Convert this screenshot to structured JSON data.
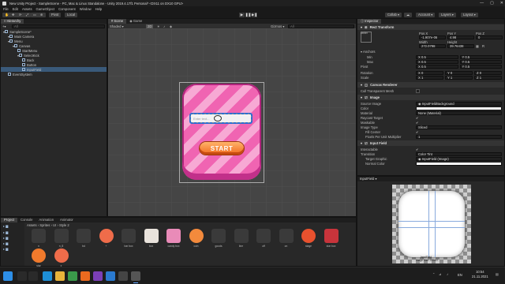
{
  "window": {
    "title": "New Unity Project - SampleScene - PC, Mac & Linux Standalone - Unity 2019.4.17f1 Personal* <DX11 on DX10 GPU>",
    "controls": [
      "—",
      "▢",
      "✕"
    ]
  },
  "menu": [
    "File",
    "Edit",
    "Assets",
    "GameObject",
    "Component",
    "Window",
    "Help"
  ],
  "toolbar": {
    "pivot": "Pivot",
    "local": "Local",
    "collab": "Collab ▾",
    "account": "Account ▾",
    "layers": "Layers ▾",
    "layout": "Layout ▾"
  },
  "hierarchy": {
    "tab": "Hierarchy",
    "search_placeholder": "All",
    "items": [
      {
        "label": "SampleScene*",
        "depth": 0
      },
      {
        "label": "Main Camera",
        "depth": 1
      },
      {
        "label": "Menu",
        "depth": 1
      },
      {
        "label": "Canvas",
        "depth": 2
      },
      {
        "label": "StartMenu",
        "depth": 3
      },
      {
        "label": "SelectKick",
        "depth": 3
      },
      {
        "label": "Back",
        "depth": 4
      },
      {
        "label": "Button",
        "depth": 4
      },
      {
        "label": "InputField",
        "depth": 4,
        "selected": true
      },
      {
        "label": "EventSystem",
        "depth": 1
      }
    ]
  },
  "scene": {
    "tabs": [
      "Scene",
      "Game"
    ],
    "shading": "Shaded",
    "mode_2d": "2D",
    "gizmos": "Gizmos ▾",
    "search_placeholder": "All",
    "input_placeholder": "Enter text...",
    "start_label": "START"
  },
  "inspector": {
    "tab": "Inspector",
    "rect_header": "Rect Transform",
    "anchor_label": "center",
    "pos_headers": [
      "Pos X",
      "Pos Y",
      "Pos Z"
    ],
    "pos_values": [
      "-1.907e-06",
      "4.98",
      "0"
    ],
    "size_headers": [
      "Width",
      "Height"
    ],
    "size_values": [
      "272.0798",
      "39.76438"
    ],
    "anchors_label": "Anchors",
    "min": {
      "label": "Min",
      "x": "X 0.5",
      "y": "Y 0.5"
    },
    "max": {
      "label": "Max",
      "x": "X 0.5",
      "y": "Y 0.5"
    },
    "pivot": {
      "label": "Pivot",
      "x": "X 0.5",
      "y": "Y 0.5"
    },
    "rotation": {
      "label": "Rotation",
      "x": "X 0",
      "y": "Y 0",
      "z": "Z 0"
    },
    "scale": {
      "label": "Scale",
      "x": "X 1",
      "y": "Y 1",
      "z": "Z 1"
    },
    "canvas_renderer": "Canvas Renderer",
    "cull_transparent": "Cull Transparent Mesh",
    "image_header": "Image",
    "source_image": {
      "label": "Source Image",
      "value": "◉ InputFieldBackground"
    },
    "color": {
      "label": "Color"
    },
    "material": {
      "label": "Material",
      "value": "None (Material)"
    },
    "raycast": {
      "label": "Raycast Target"
    },
    "maskable": {
      "label": "Maskable"
    },
    "image_type": {
      "label": "Image Type",
      "value": "Sliced"
    },
    "fill_center": {
      "label": "Fill Center"
    },
    "ppu": {
      "label": "Pixels Per Unit Multiplier",
      "value": "1"
    },
    "input_header": "Input Field",
    "interactable": {
      "label": "Interactable"
    },
    "transition": {
      "label": "Transition",
      "value": "Color Tint"
    },
    "target_graphic": {
      "label": "Target Graphic",
      "value": "◉ InputField (Image)"
    },
    "normal_color": {
      "label": "Normal Color"
    }
  },
  "preview": {
    "title": "InputField ▾",
    "caption": "InputField",
    "size_caption": "Image Size: 370x37"
  },
  "project": {
    "tabs": [
      "Project",
      "Console",
      "Animation",
      "Animator"
    ],
    "breadcrumb": "Assets › Sprites › UI › Style 2",
    "assets": [
      {
        "label": "n",
        "color": "#3a3a3a"
      },
      {
        "label": "n_8",
        "color": "#3a3a3a"
      },
      {
        "label": "bd",
        "color": "#3a3a3a"
      },
      {
        "label": "+",
        "color": "#ef6c4a"
      },
      {
        "label": "bar box",
        "color": "#3a3a3a"
      },
      {
        "label": "box",
        "color": "#e9e3dc"
      },
      {
        "label": "candy box",
        "color": "#e98bb8"
      },
      {
        "label": "coin",
        "color": "#f38a3c"
      },
      {
        "label": "goods",
        "color": "#3a3a3a"
      },
      {
        "label": "line",
        "color": "#3a3a3a"
      },
      {
        "label": "off",
        "color": "#3a3a3a"
      },
      {
        "label": "on",
        "color": "#3a3a3a"
      },
      {
        "label": "stage",
        "color": "#e8512e"
      },
      {
        "label": "star box",
        "color": "#c8343b"
      },
      {
        "label": "star",
        "color": "#f07a2c"
      },
      {
        "label": "x",
        "color": "#ef6c4a"
      }
    ]
  },
  "taskbar": {
    "icons": [
      {
        "name": "windows-start-icon",
        "color": "#2d8fe8"
      },
      {
        "name": "search-icon",
        "color": "#2a2a2a"
      },
      {
        "name": "task-view-icon",
        "color": "#2a2a2a"
      },
      {
        "name": "edge-icon",
        "color": "#1e8fd6"
      },
      {
        "name": "explorer-icon",
        "color": "#e8b33a"
      },
      {
        "name": "chrome-icon",
        "color": "#3a9a4a"
      },
      {
        "name": "firefox-icon",
        "color": "#ea6a1f"
      },
      {
        "name": "visual-studio-icon",
        "color": "#7b3fb7"
      },
      {
        "name": "store-icon",
        "color": "#2a7ad0"
      },
      {
        "name": "unity-hub-icon",
        "color": "#444444"
      },
      {
        "name": "unity-icon",
        "color": "#555555"
      }
    ],
    "lang": "EN",
    "time": "10:54",
    "date": "21.11.2021"
  }
}
